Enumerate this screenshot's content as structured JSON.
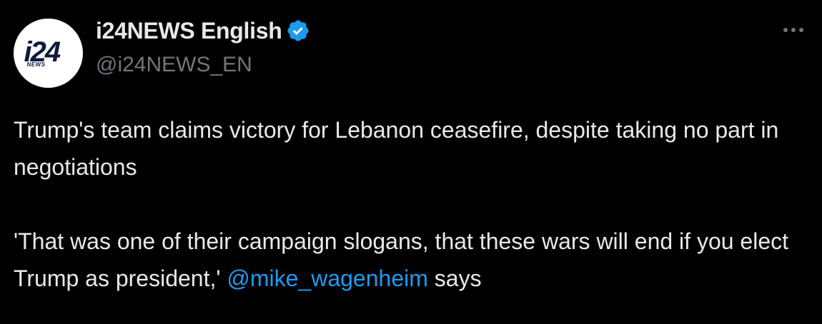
{
  "account": {
    "display_name": "i24NEWS English",
    "handle": "@i24NEWS_EN",
    "avatar_logo_text": "i24",
    "avatar_logo_sub": "NEWS",
    "verified_icon": "verified-badge-icon",
    "badge_color": "#1d9bf0"
  },
  "tweet": {
    "line1": "Trump's team claims victory for Lebanon ceasefire, despite taking no part in negotiations",
    "quote_before_mention": "'That was one of their campaign slogans, that these wars will end if you elect Trump as president,' ",
    "mention": "@mike_wagenheim",
    "after_mention": " says"
  },
  "more_icon": "more-options-icon",
  "colors": {
    "background": "#000000",
    "text": "#e7e9ea",
    "secondary_text": "#71767b",
    "link": "#1d9bf0"
  }
}
